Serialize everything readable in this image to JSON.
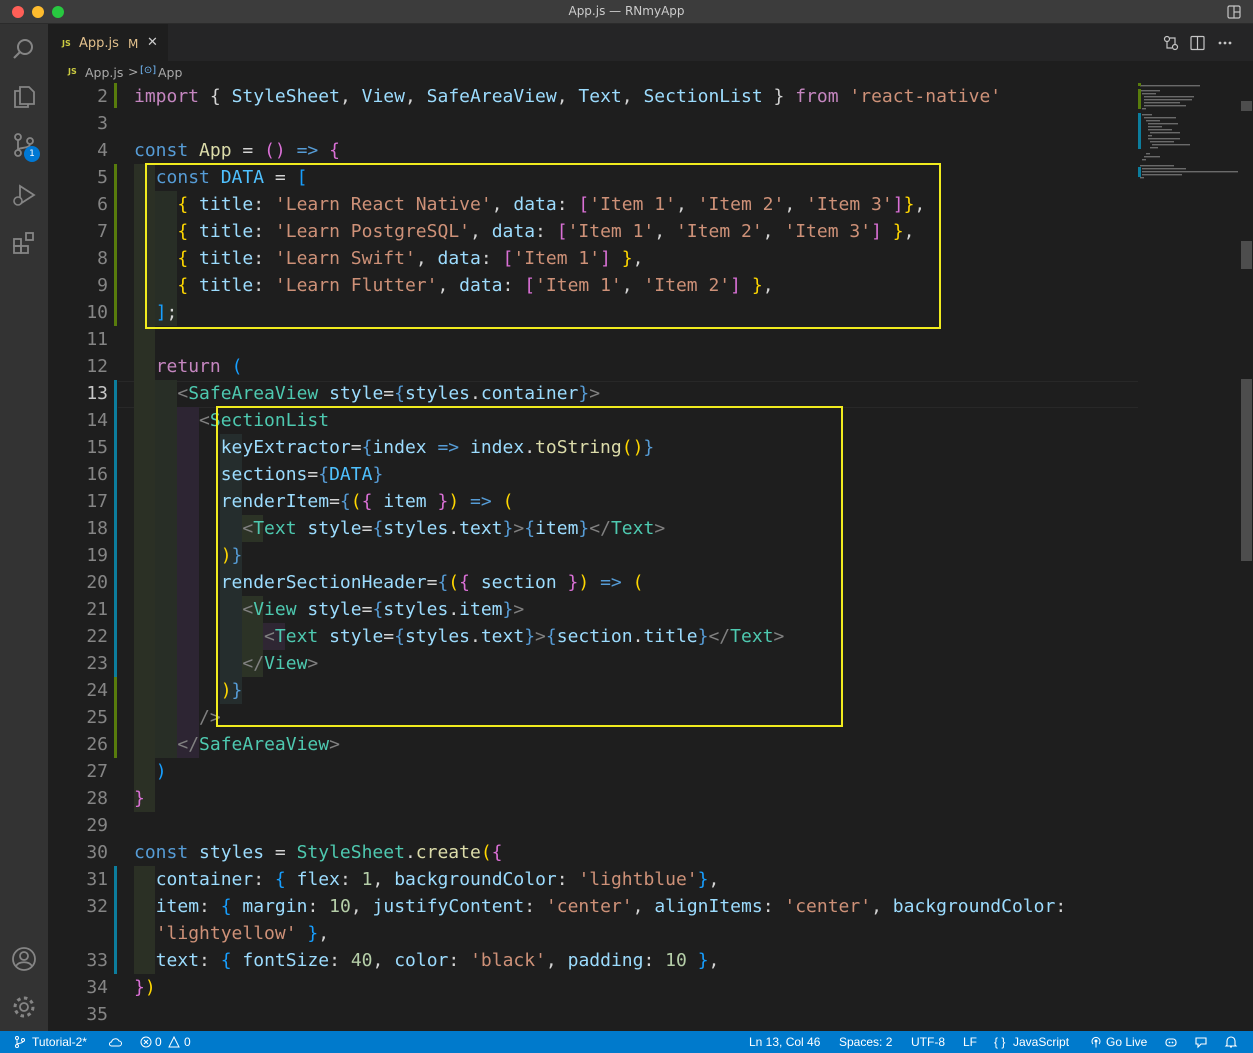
{
  "window": {
    "title": "App.js — RNmyApp"
  },
  "tab": {
    "icon": "JS",
    "label": "App.js",
    "status": "M",
    "close": "✕"
  },
  "breadcrumb": {
    "icon": "JS",
    "file": "App.js",
    "separator": ">",
    "symbol_icon": "[⊙]",
    "symbol": "App"
  },
  "activity": {
    "source_control_badge": "1"
  },
  "editor": {
    "line_numbers": [
      "2",
      "3",
      "4",
      "5",
      "6",
      "7",
      "8",
      "9",
      "10",
      "11",
      "12",
      "13",
      "14",
      "15",
      "16",
      "17",
      "18",
      "19",
      "20",
      "21",
      "22",
      "",
      "23",
      "24",
      "25",
      "26",
      "27",
      "28",
      "29",
      "30",
      "31",
      "32",
      "",
      "33",
      "34",
      "35"
    ],
    "current_line": "13"
  },
  "status": {
    "branch": "Tutorial-2*",
    "errors": "0",
    "warnings": "0",
    "position": "Ln 13, Col 46",
    "spaces": "Spaces: 2",
    "encoding": "UTF-8",
    "eol": "LF",
    "language": "JavaScript",
    "golive": "Go Live"
  }
}
